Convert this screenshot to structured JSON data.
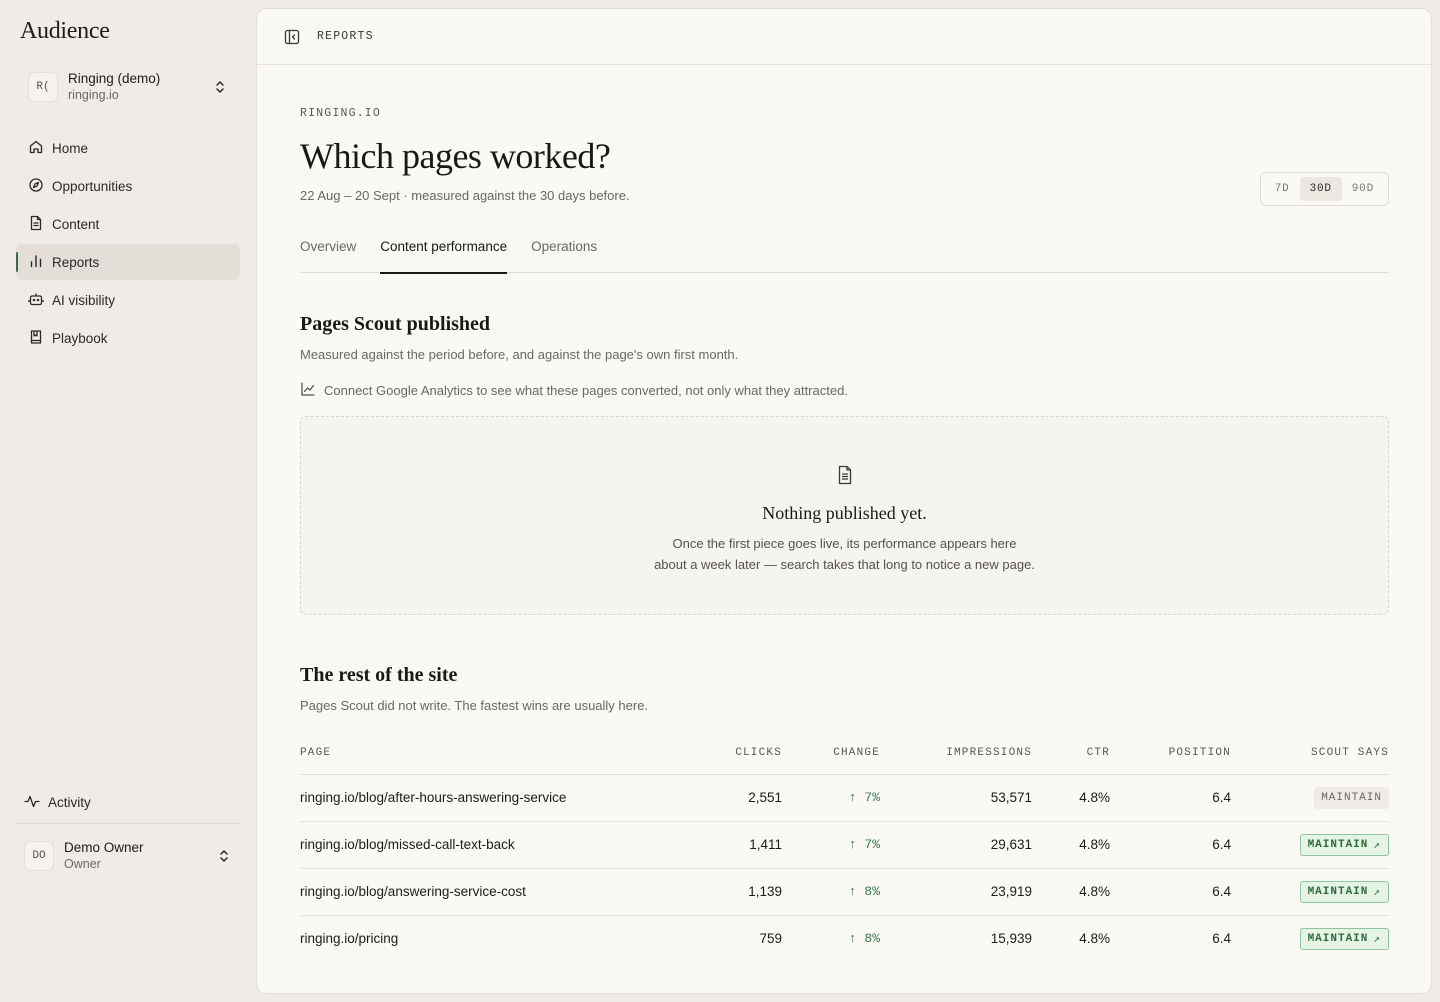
{
  "brand": "Audience",
  "org": {
    "avatar": "R(",
    "name": "Ringing (demo)",
    "domain": "ringing.io"
  },
  "nav": [
    {
      "label": "Home",
      "icon": "home-icon"
    },
    {
      "label": "Opportunities",
      "icon": "compass-icon"
    },
    {
      "label": "Content",
      "icon": "document-icon"
    },
    {
      "label": "Reports",
      "icon": "bar-chart-icon",
      "active": true
    },
    {
      "label": "AI visibility",
      "icon": "robot-icon"
    },
    {
      "label": "Playbook",
      "icon": "book-icon"
    }
  ],
  "activity_label": "Activity",
  "user": {
    "avatar": "DO",
    "name": "Demo Owner",
    "role": "Owner"
  },
  "topbar": {
    "label": "REPORTS"
  },
  "header": {
    "eyebrow": "RINGING.IO",
    "title": "Which pages worked?",
    "subtitle": "22 Aug – 20 Sept · measured against the 30 days before."
  },
  "range": {
    "options": [
      "7D",
      "30D",
      "90D"
    ],
    "selected": "30D"
  },
  "tabs": [
    {
      "label": "Overview"
    },
    {
      "label": "Content performance",
      "active": true
    },
    {
      "label": "Operations"
    }
  ],
  "section_published": {
    "title": "Pages Scout published",
    "description": "Measured against the period before, and against the page's own first month.",
    "ga_note": "Connect Google Analytics to see what these pages converted, not only what they attracted.",
    "empty_title": "Nothing published yet.",
    "empty_line1": "Once the first piece goes live, its performance appears here",
    "empty_line2": "about a week later — search takes that long to notice a new page."
  },
  "section_rest": {
    "title": "The rest of the site",
    "description": "Pages Scout did not write. The fastest wins are usually here."
  },
  "table": {
    "headers": {
      "page": "PAGE",
      "clicks": "CLICKS",
      "change": "CHANGE",
      "impressions": "IMPRESSIONS",
      "ctr": "CTR",
      "position": "POSITION",
      "scout": "SCOUT SAYS"
    },
    "rows": [
      {
        "page": "ringing.io/blog/after-hours-answering-service",
        "clicks": "2,551",
        "change": "7%",
        "impressions": "53,571",
        "ctr": "4.8%",
        "position": "6.4",
        "scout": "MAINTAIN",
        "scout_style": "plain"
      },
      {
        "page": "ringing.io/blog/missed-call-text-back",
        "clicks": "1,411",
        "change": "7%",
        "impressions": "29,631",
        "ctr": "4.8%",
        "position": "6.4",
        "scout": "MAINTAIN",
        "scout_style": "green"
      },
      {
        "page": "ringing.io/blog/answering-service-cost",
        "clicks": "1,139",
        "change": "8%",
        "impressions": "23,919",
        "ctr": "4.8%",
        "position": "6.4",
        "scout": "MAINTAIN",
        "scout_style": "green"
      },
      {
        "page": "ringing.io/pricing",
        "clicks": "759",
        "change": "8%",
        "impressions": "15,939",
        "ctr": "4.8%",
        "position": "6.4",
        "scout": "MAINTAIN",
        "scout_style": "green"
      }
    ]
  },
  "colors": {
    "accent": "#3c6b4a",
    "positive": "#3c7a4e",
    "badge_green_bg": "#e6f4e6",
    "badge_green_border": "#8fc69b"
  }
}
